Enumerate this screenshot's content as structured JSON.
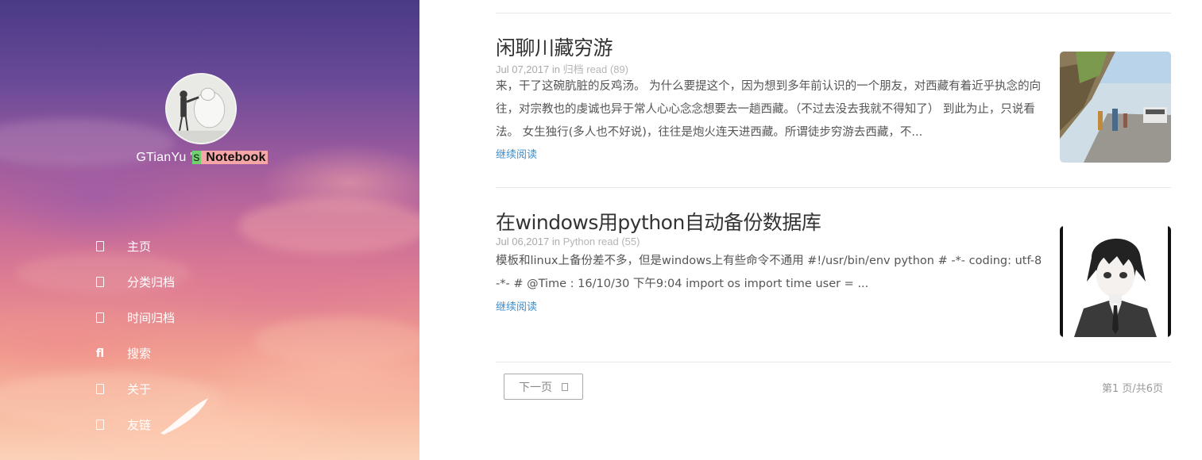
{
  "sidebar": {
    "site_title_prefix": "GTianYu '",
    "site_title_s": "s",
    "site_title_notebook": " Notebook",
    "nav": [
      {
        "label": "主页",
        "icon": "home-icon"
      },
      {
        "label": "分类归档",
        "icon": "category-icon"
      },
      {
        "label": "时间归档",
        "icon": "archive-icon"
      },
      {
        "label": "搜索",
        "icon": "search-icon",
        "glyph": "fl"
      },
      {
        "label": "关于",
        "icon": "user-icon"
      },
      {
        "label": "友链",
        "icon": "link-icon"
      }
    ]
  },
  "posts": [
    {
      "title": "闲聊川藏穷游",
      "date": "Jul 07,2017",
      "in": "in",
      "category": "归档",
      "reads": "read (89)",
      "excerpt": "来，干了这碗肮脏的反鸡汤。 为什么要提这个，因为想到多年前认识的一个朋友，对西藏有着近乎执念的向往，对宗教也的虔诚也异于常人心心念念想要去一趟西藏。（不过去没去我就不得知了） 到此为止，只说看法。 女生独行(多人也不好说)，往往是炮火连天进西藏。所谓徒步穷游去西藏，不...",
      "more": "继续阅读"
    },
    {
      "title": "在windows用python自动备份数据库",
      "date": "Jul 06,2017",
      "in": "in",
      "category": "Python",
      "reads": "read (55)",
      "excerpt": "模板和linux上备份差不多，但是windows上有些命令不通用 #!/usr/bin/env python # -*- coding: utf-8 -*- # @Time : 16/10/30 下午9:04 import os import time user = ...",
      "more": "继续阅读"
    }
  ],
  "pager": {
    "next_label": "下一页",
    "page_info": "第1 页/共6页"
  },
  "colors": {
    "link": "#3a8fd0",
    "title": "#333333",
    "meta": "#aaaaaa"
  }
}
